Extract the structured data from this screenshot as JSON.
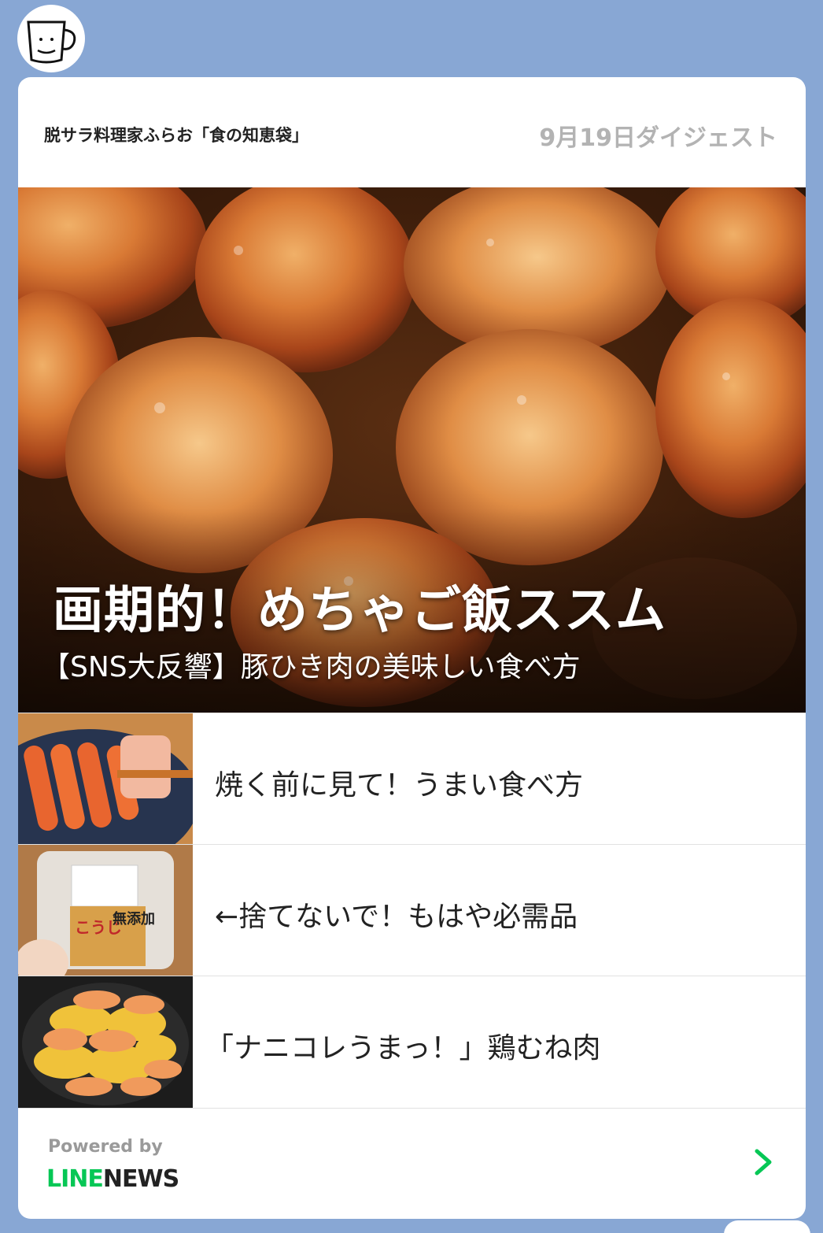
{
  "header": {
    "account_name": "脱サラ料理家ふらお「食の知恵袋」",
    "digest_date": "9月19日ダイジェスト"
  },
  "hero": {
    "title": "画期的！めちゃご飯ススム",
    "subtitle": "【SNS大反響】豚ひき肉の美味しい食べ方"
  },
  "articles": [
    {
      "label": "焼く前に見て！うまい食べ方",
      "thumb_icon": "sausage-thumbnail"
    },
    {
      "label": "←捨てないで！もはや必需品",
      "thumb_icon": "miso-container-thumbnail"
    },
    {
      "label": "「ナニコレうまっ！」鶏むね肉",
      "thumb_icon": "chicken-pan-thumbnail"
    }
  ],
  "footer": {
    "powered_by": "Powered by",
    "brand_line": "LINE",
    "brand_news": "NEWS",
    "arrow_icon": "chevron-right-icon"
  },
  "thumb_text": {
    "miso_label": "こうじ",
    "miso_badge": "無添加"
  },
  "colors": {
    "background": "#88a7d4",
    "card": "#ffffff",
    "line_green": "#06c755",
    "date_gray": "#b3b3b3"
  }
}
